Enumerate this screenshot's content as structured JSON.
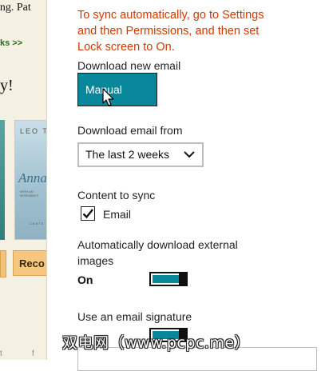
{
  "background_page": {
    "headline_fragment": "ing. Pat",
    "link_fragment": "ks >>",
    "heading_fragment": "y!",
    "book": {
      "author_fragment": "LEO T",
      "title_fragment": "Anna",
      "subtitle_fragment": "WITH AN INTRODUCT",
      "footer_fragment": "CENTE"
    },
    "button_fragment": "Reco",
    "bottom_left": "t",
    "bottom_right": "f"
  },
  "settings": {
    "sync_note": "To sync automatically, go to Settings and then Permissions, and then set Lock screen to On.",
    "download_new_email": {
      "label": "Download new email",
      "value": "Manual"
    },
    "download_email_from": {
      "label": "Download email from",
      "value": "The last 2 weeks"
    },
    "content_to_sync": {
      "label": "Content to sync",
      "items": [
        {
          "label": "Email",
          "checked": true
        }
      ]
    },
    "auto_download_images": {
      "label": "Automatically download external images",
      "state": "On",
      "on": true
    },
    "email_signature": {
      "label": "Use an email signature",
      "on": true
    }
  },
  "watermark": "双电网（www.pcpc.me）",
  "colors": {
    "accent": "#08869a",
    "note": "#cc3a00",
    "toggle_thumb": "#0f0f0f"
  }
}
